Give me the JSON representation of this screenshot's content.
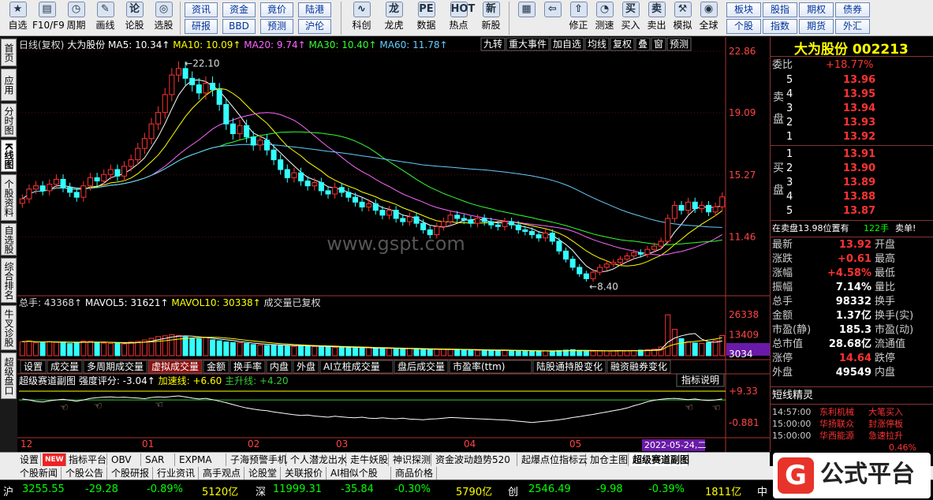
{
  "toolbar": {
    "groups": [
      {
        "icon": "★",
        "label": "自选"
      },
      {
        "icon": "▤",
        "label": "F10/F9"
      },
      {
        "icon": "◷",
        "label": "周期"
      },
      {
        "icon": "✎",
        "label": "画线"
      },
      {
        "icon": "论",
        "label": "论股"
      },
      {
        "icon": "◎",
        "label": "选股"
      }
    ],
    "small_buttons": [
      "资讯",
      "资金",
      "竟价",
      "陆港",
      "研报",
      "BBD",
      "预测",
      "沪伦"
    ],
    "groups2": [
      {
        "icon": "∿",
        "label": "科创"
      },
      {
        "icon": "龙",
        "label": "龙虎"
      },
      {
        "icon": "PE",
        "label": "数据"
      },
      {
        "icon": "HOT",
        "label": "热点"
      },
      {
        "icon": "新",
        "label": "新股"
      }
    ],
    "groups3": [
      {
        "icon": "▦",
        "label": ""
      },
      {
        "icon": "⇦",
        "label": ""
      },
      {
        "icon": "⇧",
        "label": "修正"
      },
      {
        "icon": "◔",
        "label": "测速"
      },
      {
        "icon": "买",
        "label": "买入"
      },
      {
        "icon": "卖",
        "label": "卖出"
      },
      {
        "icon": "⚒",
        "label": "模拟"
      },
      {
        "icon": "◉",
        "label": "全球"
      }
    ],
    "small_buttons2": [
      "板块",
      "股指",
      "期权",
      "债券",
      "个股",
      "指数",
      "期货",
      "外汇"
    ]
  },
  "left_tabs": [
    "首页",
    "应用",
    "分时图",
    "K线图",
    "个股资料",
    "自选股",
    "综合排名",
    "牛叉诊股",
    "超级盘口"
  ],
  "chart_header": {
    "title": "日线(复权)",
    "stock": "大为股份",
    "ma": [
      {
        "label": "MA5: 10.34",
        "color": "#ffffff"
      },
      {
        "label": "MA10: 10.09",
        "color": "#ffff00"
      },
      {
        "label": "MA20: 9.74",
        "color": "#ff66ff"
      },
      {
        "label": "MA30: 10.40",
        "color": "#33ff33"
      },
      {
        "label": "MA60: 11.78",
        "color": "#66ccff"
      }
    ],
    "right_buttons": [
      "九转",
      "重大事件",
      "加自选",
      "均线",
      "复权",
      "叠",
      "窗",
      "预测"
    ]
  },
  "price_axis": [
    "22.86",
    "19.09",
    "15.27",
    "11.46"
  ],
  "price_labels": {
    "high": "22.10",
    "low": "8.40"
  },
  "volume_header": {
    "label": "总手: 43368",
    "mavol5": "MAVOL5: 31621",
    "mavol10": "MAVOL10: 30338",
    "note": "成交量已复权"
  },
  "volume_axis": [
    "26338",
    "13409",
    "3034"
  ],
  "indicator_tabs": [
    "设置",
    "成交量",
    "多周期成交量",
    "虚拟成交量",
    "金额",
    "换手率",
    "内盘",
    "外盘",
    "AI立桩成交量",
    "盘后成交量",
    "市盈率(ttm)",
    "陆股通持股变化",
    "融资融券变化"
  ],
  "indicator_header": {
    "name": "超级赛道副图",
    "score": "强度评分: -3.04",
    "speed": "加速线: +6.60",
    "main": "主升线: +4.20",
    "explain": "指标说明"
  },
  "indicator_axis": [
    "9.33",
    "-0.881"
  ],
  "x_axis": [
    "12",
    "01",
    "02",
    "03",
    "04",
    "05"
  ],
  "date_label": "2022-05-24,二",
  "watermark": "www.gspt.com",
  "right_panel": {
    "title": "大为股份 002213",
    "webi_label": "委比",
    "webi": "+18.77%",
    "sell_label": "卖盘",
    "buy_label": "买盘",
    "sell": [
      {
        "n": "5",
        "p": "13.96"
      },
      {
        "n": "4",
        "p": "13.95"
      },
      {
        "n": "3",
        "p": "13.94"
      },
      {
        "n": "2",
        "p": "13.93"
      },
      {
        "n": "1",
        "p": "13.92"
      }
    ],
    "buy": [
      {
        "n": "1",
        "p": "13.91"
      },
      {
        "n": "2",
        "p": "13.90"
      },
      {
        "n": "3",
        "p": "13.89"
      },
      {
        "n": "4",
        "p": "13.88"
      },
      {
        "n": "5",
        "p": "13.87"
      }
    ],
    "order_note": "在卖盘13.98位置有",
    "order_qty": "122手",
    "order_tag": "卖单!",
    "stats": [
      {
        "l": "最新",
        "v": "13.92",
        "r": "开盘"
      },
      {
        "l": "涨跌",
        "v": "+0.61",
        "r": "最高"
      },
      {
        "l": "涨幅",
        "v": "+4.58%",
        "r": "最低"
      },
      {
        "l": "振幅",
        "v": "7.14%",
        "r": "量比"
      },
      {
        "l": "总手",
        "v": "98332",
        "r": "换手"
      },
      {
        "l": "金额",
        "v": "1.37亿",
        "r": "换手(实)"
      },
      {
        "l": "市盈(静)",
        "v": "185.3",
        "r": "市盈(动)"
      },
      {
        "l": "总市值",
        "v": "28.68亿",
        "r": "流通值"
      },
      {
        "l": "涨停",
        "v": "14.64",
        "r": "跌停"
      },
      {
        "l": "外盘",
        "v": "49549",
        "r": "内盘"
      }
    ],
    "short_title": "短线精灵",
    "short_items": [
      {
        "t": "14:57:00",
        "s": "东利机械",
        "e": "大笔买入"
      },
      {
        "t": "15:00:00",
        "s": "华扬联众",
        "e": "封涨停板"
      },
      {
        "t": "15:00:00",
        "s": "华西能源",
        "e": "急速拉升"
      }
    ],
    "partial": "0.46%"
  },
  "bottom_tabs": [
    "设置",
    "NEW",
    "指标平台",
    "OBV",
    "SAR",
    "EXPMA",
    "子海预警手机",
    "个人潜龙出水",
    "走牛妖股",
    "神识探测",
    "资金波动趋势520",
    "起爆点位指标云",
    "加仓主图",
    "超级赛道副图"
  ],
  "bottom_tabs2": [
    "个股新闻",
    "个股公告",
    "个股研报",
    "行业资讯",
    "高手观点",
    "论股堂",
    "关联报价",
    "AI相似个股",
    "商品价格"
  ],
  "status": {
    "sh_label": "沪",
    "sh_price": "3255.55",
    "sh_chg": "-29.28",
    "sh_pct": "-0.89%",
    "sh_amt": "5120亿",
    "sz_label": "深",
    "sz_price": "11999.31",
    "sz_chg": "-35.84",
    "sz_pct": "-0.30%",
    "sz_amt": "5790亿",
    "cy_label": "创",
    "cy_price": "2546.49",
    "cy_chg": "-9.98",
    "cy_pct": "-0.39%",
    "cy_amt": "1811亿",
    "zh_label": "中"
  },
  "logo": {
    "mark": "G",
    "text": "公式平台"
  },
  "colors": {
    "up": "#ff3333",
    "down": "#33ffff",
    "accent": "#ffff00"
  },
  "chart_data": {
    "type": "candlestick",
    "x_ticks": [
      "12",
      "01",
      "02",
      "03",
      "04",
      "05"
    ],
    "ylim": [
      8.0,
      22.86
    ],
    "high_label": 22.1,
    "low_label": 8.4,
    "close": [
      13.8,
      14.4,
      14.6,
      14.3,
      14.7,
      15.0,
      14.5,
      14.2,
      13.9,
      14.6,
      15.1,
      14.9,
      15.3,
      15.6,
      15.2,
      15.8,
      16.2,
      16.9,
      17.5,
      18.4,
      19.1,
      20.2,
      21.4,
      21.8,
      21.2,
      20.8,
      20.3,
      20.9,
      20.5,
      19.6,
      18.4,
      17.8,
      18.3,
      17.6,
      17.1,
      17.4,
      16.8,
      16.2,
      15.6,
      15.1,
      15.4,
      14.9,
      14.6,
      14.8,
      14.3,
      14.1,
      14.5,
      14.2,
      13.9,
      13.6,
      13.3,
      13.5,
      13.1,
      12.8,
      13.1,
      12.6,
      12.4,
      12.7,
      12.3,
      11.9,
      11.6,
      12.1,
      12.4,
      12.8,
      12.6,
      12.5,
      12.3,
      12.6,
      12.4,
      12.2,
      12.1,
      12.4,
      12.2,
      11.9,
      11.8,
      11.6,
      11.4,
      11.7,
      11.2,
      10.6,
      10.1,
      9.6,
      9.2,
      8.9,
      9.3,
      9.6,
      9.8,
      9.9,
      10.1,
      10.3,
      10.5,
      10.4,
      10.7,
      10.9,
      11.2,
      12.6,
      13.4,
      13.1,
      13.6,
      13.2,
      13.4,
      13.0,
      13.31,
      13.92
    ],
    "volume_ylim": [
      0,
      30000
    ],
    "volume": [
      9000,
      9500,
      8200,
      8800,
      9100,
      8600,
      8900,
      7800,
      8300,
      9400,
      9200,
      8700,
      8100,
      7900,
      8400,
      7600,
      8800,
      9200,
      10100,
      11200,
      12300,
      12800,
      13600,
      12900,
      12100,
      11300,
      10900,
      11600,
      10200,
      9600,
      8900,
      8500,
      8300,
      7900,
      7200,
      6900,
      6600,
      7100,
      6800,
      6300,
      6100,
      6500,
      6200,
      5900,
      5600,
      5800,
      5400,
      5600,
      5200,
      5000,
      4800,
      5100,
      4600,
      4900,
      4700,
      4500,
      4300,
      4600,
      4200,
      4000,
      3800,
      4100,
      4300,
      4000,
      3800,
      3700,
      3600,
      3500,
      3400,
      3300,
      3500,
      3400,
      3300,
      3200,
      3100,
      3000,
      2900,
      3100,
      2800,
      3300,
      3600,
      3900,
      3400,
      3100,
      2900,
      3000,
      3100,
      3200,
      3300,
      3100,
      3400,
      3600,
      3800,
      4200,
      5600,
      26338,
      17000,
      11000,
      9000,
      8200,
      7900,
      8400,
      9800,
      13000
    ],
    "indicator": [
      6.8,
      6.5,
      6.0,
      5.8,
      6.2,
      6.5,
      6.7,
      6.4,
      6.1,
      6.5,
      7.0,
      7.2,
      7.4,
      7.5,
      7.3,
      7.4,
      7.2,
      7.1,
      6.9,
      7.3,
      7.5,
      7.4,
      7.6,
      7.8,
      7.5,
      7.1,
      6.8,
      7.0,
      6.6,
      6.1,
      5.6,
      5.0,
      4.4,
      3.9,
      3.5,
      3.2,
      3.0,
      2.6,
      2.3,
      2.0,
      1.7,
      1.5,
      1.6,
      1.3,
      1.1,
      0.9,
      1.2,
      1.0,
      0.8,
      0.7,
      0.9,
      0.6,
      0.5,
      0.7,
      0.5,
      0.4,
      0.6,
      0.3,
      0.2,
      0.1,
      0.3,
      0.4,
      0.6,
      0.8,
      0.7,
      0.6,
      0.5,
      0.4,
      0.3,
      0.2,
      0.1,
      0.0,
      -0.2,
      -0.4,
      -0.6,
      -0.8,
      -0.6,
      -0.4,
      -0.2,
      0.1,
      0.4,
      0.8,
      1.1,
      1.5,
      1.8,
      2.2,
      2.6,
      3.0,
      3.4,
      3.9,
      4.6,
      5.2,
      5.9,
      6.4,
      6.7,
      6.9,
      7.0,
      6.8,
      6.6,
      6.8,
      6.5,
      6.3,
      6.5,
      6.8
    ]
  }
}
